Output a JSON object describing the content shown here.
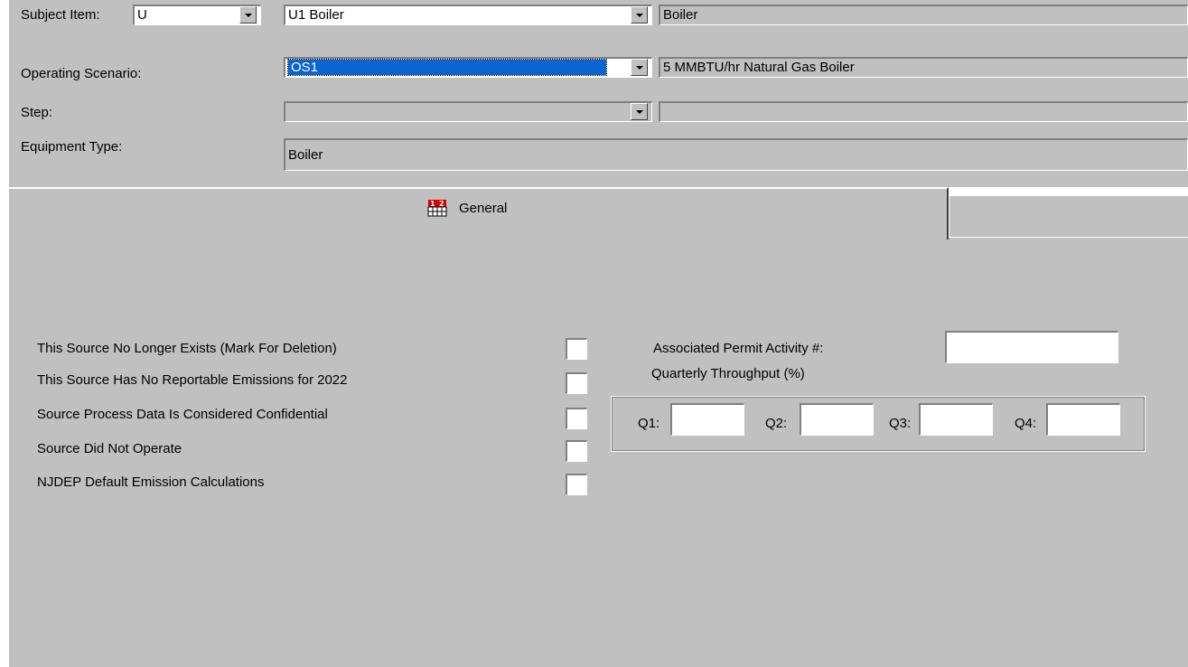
{
  "header": {
    "subject_item": {
      "label": "Subject Item:",
      "type_value": "U",
      "item_value": "U1 Boiler",
      "description": "Boiler"
    },
    "operating_scenario": {
      "label": "Operating Scenario:",
      "value": "OS1",
      "description": "5 MMBTU/hr Natural Gas Boiler"
    },
    "step": {
      "label": "Step:",
      "value": "",
      "description": ""
    },
    "equipment_type": {
      "label": "Equipment Type:",
      "value": "Boiler"
    }
  },
  "tabs": [
    {
      "label": "General",
      "icon": "table-grid-icon",
      "active": true
    },
    {
      "label": "",
      "active": false
    }
  ],
  "general": {
    "checkboxes": [
      {
        "label": "This Source No Longer Exists (Mark For Deletion)",
        "checked": false
      },
      {
        "label": "This Source Has No Reportable Emissions for 2022",
        "checked": false
      },
      {
        "label": "Source Process Data Is Considered Confidential",
        "checked": false
      },
      {
        "label": "Source Did Not Operate",
        "checked": false
      },
      {
        "label": "NJDEP Default Emission Calculations",
        "checked": false
      }
    ],
    "permit_activity": {
      "label": "Associated Permit Activity #:",
      "value": ""
    },
    "quarterly": {
      "label": "Quarterly Throughput (%)",
      "q1_label": "Q1:",
      "q1_value": "",
      "q2_label": "Q2:",
      "q2_value": "",
      "q3_label": "Q3:",
      "q3_value": "",
      "q4_label": "Q4:",
      "q4_value": ""
    }
  },
  "colors": {
    "panel": "#c0c0c0",
    "selection": "#0a64d2",
    "field": "#ffffff"
  }
}
